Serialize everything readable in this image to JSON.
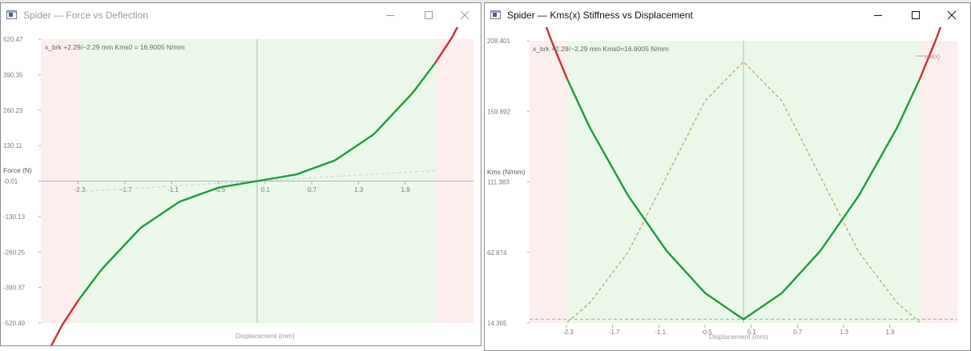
{
  "windows": [
    {
      "title": "Spider — Force vs Deflection",
      "active": false,
      "controls": [
        "minimize-icon",
        "maximize-icon",
        "close-icon"
      ]
    },
    {
      "title": "Spider — Kms(x) Stiffness vs Displacement",
      "active": true,
      "controls": [
        "minimize-icon",
        "maximize-icon",
        "close-icon"
      ]
    }
  ],
  "chart_data": [
    {
      "type": "line",
      "annotation": "x_brk +2.29/−2.29 mm   Kms0 = 16.9005 N/mm",
      "xlabel": "Displacement (mm)",
      "ylabel": "Force (N)",
      "xlim": [
        -2.78,
        2.78
      ],
      "ylim": [
        -520.49,
        520.47
      ],
      "x_ticks": [
        -2.3,
        -1.7,
        -1.1,
        -0.5,
        0.1,
        0.7,
        1.3,
        1.9
      ],
      "x_tick_labels": [
        "-2.3",
        "-1.7",
        "-1.1",
        "-0.5",
        "0.1",
        "0.7",
        "1.3",
        "1.9"
      ],
      "y_ticks": [
        520.47,
        390.35,
        260.23,
        130.11,
        -0.01,
        -130.13,
        -260.25,
        -390.37,
        -520.49
      ],
      "y_tick_labels": [
        "520.47",
        "390.35",
        "260.23",
        "130.11",
        "-0.01",
        "-130.13",
        "-260.25",
        "-390.37",
        "-520.49"
      ],
      "linear_zone": [
        -2.29,
        2.29
      ],
      "colors": {
        "zone_inside": "#ebf7e9",
        "zone_outside": "#fbeeed",
        "curve": "#1e9b3a",
        "curve_outside": "#c83232",
        "reference": "#c8dce8",
        "axis": "#b9c9b9"
      },
      "series": [
        {
          "style": "solid",
          "x": [
            -2.78,
            -2.5,
            -2.29,
            -2.0,
            -1.5,
            -1.0,
            -0.5,
            0.0,
            0.5,
            1.0,
            1.5,
            2.0,
            2.29,
            2.5,
            2.78
          ],
          "y": [
            -676,
            -525,
            -434,
            -324,
            -172,
            -76,
            -24,
            0,
            24,
            76,
            172,
            324,
            434,
            525,
            676
          ]
        },
        {
          "style": "dashed",
          "x": [
            -2.29,
            2.29
          ],
          "y": [
            -38.7,
            38.7
          ]
        }
      ]
    },
    {
      "type": "line",
      "annotation": "x_brk +2.29/−2.29 mm   Kms0=16.9005 N/mm",
      "xlabel": "Displacement (mm)",
      "ylabel": "Kms (N/mm)",
      "legend": "eta(x)",
      "xlim": [
        -2.78,
        2.78
      ],
      "ylim": [
        14.365,
        208.401
      ],
      "x_ticks": [
        -2.3,
        -1.7,
        -1.1,
        -0.5,
        0.1,
        0.7,
        1.3,
        1.9
      ],
      "x_tick_labels": [
        "-2.3",
        "-1.7",
        "-1.1",
        "-0.5",
        "0.1",
        "0.7",
        "1.3",
        "1.9"
      ],
      "y_ticks": [
        208.401,
        159.892,
        111.383,
        62.874,
        14.365
      ],
      "y_tick_labels": [
        "208.401",
        "159.892",
        "111.383",
        "62.874",
        "14.365"
      ],
      "linear_zone": [
        -2.29,
        2.29
      ],
      "colors": {
        "zone_inside": "#ebf7e9",
        "zone_outside": "#fbeeed",
        "curve": "#1e9b3a",
        "curve_outside": "#c83232",
        "dashed": "#c4a35a",
        "baseline": "#8fcf9d",
        "axis": "#b9c9b9"
      },
      "series": [
        {
          "style": "solid",
          "x": [
            -2.78,
            -2.5,
            -2.29,
            -2.0,
            -1.5,
            -1.0,
            -0.5,
            0.0,
            0.5,
            1.0,
            1.5,
            2.0,
            2.29,
            2.5,
            2.78
          ],
          "y": [
            249,
            209,
            182,
            149,
            102,
            64,
            35,
            16.9,
            35,
            64,
            102,
            149,
            182,
            209,
            249
          ]
        },
        {
          "name": "eta(x)",
          "style": "dashed",
          "x": [
            -2.29,
            -2.0,
            -1.5,
            -1.0,
            -0.5,
            0.0,
            0.5,
            1.0,
            1.5,
            2.0,
            2.29
          ],
          "y": [
            15,
            28,
            63,
            115,
            167,
            194,
            167,
            115,
            63,
            28,
            15
          ]
        },
        {
          "style": "dashed",
          "x": [
            -2.78,
            2.78
          ],
          "y": [
            16.9,
            16.9
          ]
        }
      ]
    }
  ]
}
